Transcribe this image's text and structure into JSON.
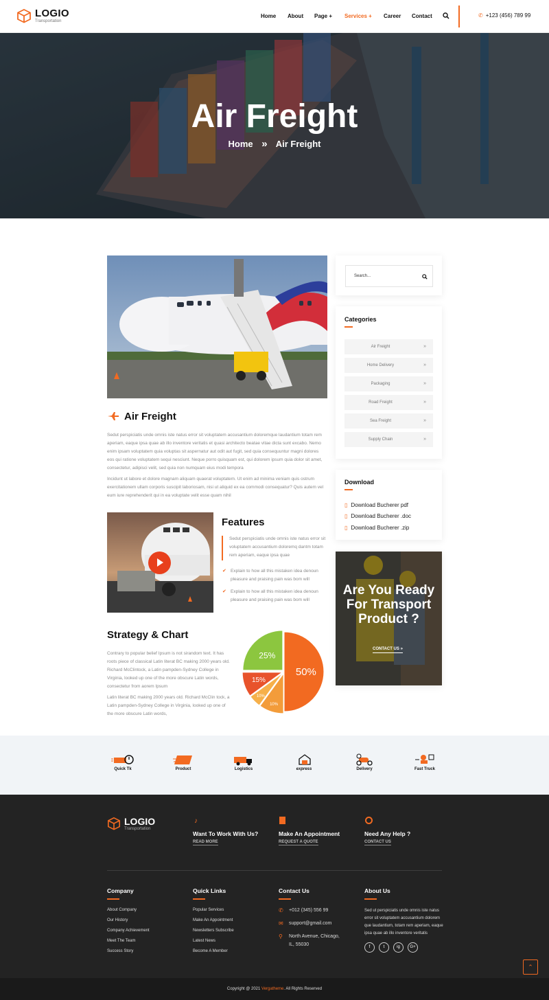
{
  "brand": {
    "name": "LOGIO",
    "tagline": "Transportation"
  },
  "nav": {
    "items": [
      "Home",
      "About",
      "Page +",
      "Services +",
      "Career",
      "Contact"
    ],
    "phone": "+123 (456) 789 99"
  },
  "hero": {
    "title": "Air Freight",
    "crumb_home": "Home",
    "crumb_sep": "»",
    "crumb_current": "Air Freight"
  },
  "main": {
    "heading": "Air Freight",
    "para1": "Sedut perspiciatis unde omnis iste natus error sit voluptatem accusantium doloremque laudantium totam rem aperiam, eaque ipsa quae ab illo inventore veritatis et quasi architecto beatae vitae dicta sunt excabo. Nemo enim ipsam voluptatem quia voluptas sit aspernatur aut odit aut fugit, sed quia consequuntur magni dolores eos qui ratione voluptatem sequi nesciunt. Neque porro quisquam est, qui dolorem ipsum quia dolor sit amet, consectetur, adipisci velit, sed quia non numquam eius modi tempora",
    "para2": "Incidunt ut labore et dolore magnam aliquam quaerat voluptatem. Ut enim ad minima veniam quis ostrum exercitationem ullam corporis suscipit laboriosam, nisi ut aliquid ex ea commodi consequatur? Quis autem vel eum iure reprehenderit qui in ea voluptate velit esse quam nihil",
    "features_heading": "Features",
    "features_quote": "Sedut perspiciatis unde omnis iste natus error sit voluptatem accusantium doloremq dantm totam rem aperiam, eaque ipsa quae",
    "features_items": [
      "Explain to how all this mistaken idea denoun pleasure and praising pain was bom will",
      "Explain to how all this mistaken idea denoun pleasure and praising pain was bom will"
    ],
    "strategy_heading": "Strategy & Chart",
    "strategy_para1": "Contrary to popular belief Ipsum is not sirandom text. It has roots piece of classical Latin literat BC making 2000 years old. Richard McClintock, a Latin pampden-Sydney College in Virginia, looked up one of the more obscure Latin words, consectetur from aorem Ipsum",
    "strategy_para2": "Latin literat BC making 2000 years old. Richard McClin tock, a Latin pampden-Sydney College in Virginia, looked up one of the more obscure Latin words,"
  },
  "chart_data": {
    "type": "pie",
    "slices": [
      {
        "label": "50%",
        "value": 50,
        "color": "#f26a21"
      },
      {
        "label": "10%",
        "value": 10,
        "color": "#f39c3a"
      },
      {
        "label": "10%",
        "value": 5,
        "color": "#f6b04a"
      },
      {
        "label": "15%",
        "value": 10,
        "color": "#e8532b"
      },
      {
        "label": "25%",
        "value": 25,
        "color": "#8cc63f"
      }
    ]
  },
  "sidebar": {
    "search_placeholder": "Search...",
    "categories_title": "Categories",
    "categories": [
      "Air Freight",
      "Home Delivery",
      "Packaging",
      "Road Freight",
      "Sea Freight",
      "Supply Chain"
    ],
    "download_title": "Download",
    "downloads": [
      "Download Bucherer pdf",
      "Download Bucherer .doc",
      "Download Bucherer .zip"
    ],
    "cta_title": "Are You Ready For Transport Product ?",
    "cta_link": "CONTACT US"
  },
  "partners": [
    "Quick Tk",
    "Product",
    "Logistics",
    "express",
    "Delivery",
    "Fast Truck"
  ],
  "footer": {
    "brand": "LOGIO",
    "tagline": "Transportation",
    "blocks": [
      {
        "title": "Want To Work With Us?",
        "link": "READ MORE"
      },
      {
        "title": "Make An Appointment",
        "link": "REQUEST A QUOTE"
      },
      {
        "title": "Need Any Help ?",
        "link": "CONTACT US"
      }
    ],
    "company_title": "Company",
    "company_links": [
      "About Company",
      "Our History",
      "Company Achievement",
      "Meet The Team",
      "Success Story"
    ],
    "quick_title": "Quick Links",
    "quick_links": [
      "Popular Services",
      "Make An Appointment",
      "Newsletters Subscribe",
      "Latest News",
      "Become A Member"
    ],
    "contact_title": "Contact Us",
    "contact_phone": "+012 (345) 556 99",
    "contact_email": "support@gmail.com",
    "contact_address": "North Avenue, Chicago, IL, 55030",
    "about_title": "About Us",
    "about_text": "Sed ut perspiciatis unde omnis iste natus error sit voluptatem accusantium dolorem que laudantium, totam rem aperiam, eaque ipsa quae ab illo inventore veritatis",
    "socials": [
      "f",
      "t",
      "ig",
      "G+"
    ],
    "copyright_prefix": "Copyright @ 2021 ",
    "copyright_brand": "Vergatheme",
    "copyright_suffix": ". All Rights Reserved"
  },
  "colors": {
    "accent": "#f26a21",
    "dark": "#232323",
    "green": "#8cc63f"
  }
}
